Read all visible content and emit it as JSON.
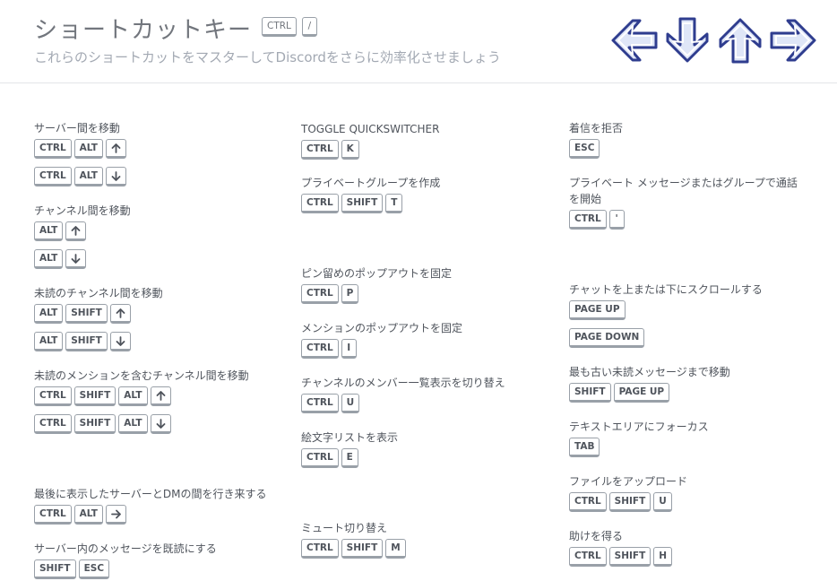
{
  "header": {
    "title": "ショートカットキー",
    "title_keys": [
      "CTRL",
      "/"
    ],
    "subtitle": "これらのショートカットをマスターしてDiscordをさらに効率化させましょう"
  },
  "columns": [
    [
      {
        "label": "サーバー間を移動",
        "rows": [
          [
            "CTRL",
            "ALT",
            "↑"
          ],
          [
            "CTRL",
            "ALT",
            "↓"
          ]
        ]
      },
      {
        "label": "チャンネル間を移動",
        "rows": [
          [
            "ALT",
            "↑"
          ],
          [
            "ALT",
            "↓"
          ]
        ]
      },
      {
        "label": "未読のチャンネル間を移動",
        "rows": [
          [
            "ALT",
            "SHIFT",
            "↑"
          ],
          [
            "ALT",
            "SHIFT",
            "↓"
          ]
        ]
      },
      {
        "label": "未読のメンションを含むチャンネル間を移動",
        "rows": [
          [
            "CTRL",
            "SHIFT",
            "ALT",
            "↑"
          ],
          [
            "CTRL",
            "SHIFT",
            "ALT",
            "↓"
          ]
        ]
      },
      {
        "label": "最後に表示したサーバーとDMの間を行き来する",
        "rows": [
          [
            "CTRL",
            "ALT",
            "→"
          ]
        ]
      },
      {
        "label": "サーバー内のメッセージを既読にする",
        "rows": [
          [
            "SHIFT",
            "ESC"
          ]
        ]
      }
    ],
    [
      {
        "label": "TOGGLE QUICKSWITCHER",
        "rows": [
          [
            "CTRL",
            "K"
          ]
        ]
      },
      {
        "label": "プライベートグループを作成",
        "rows": [
          [
            "CTRL",
            "SHIFT",
            "T"
          ]
        ]
      },
      {
        "label": "ピン留めのポップアウトを固定",
        "rows": [
          [
            "CTRL",
            "P"
          ]
        ]
      },
      {
        "label": "メンションのポップアウトを固定",
        "rows": [
          [
            "CTRL",
            "I"
          ]
        ]
      },
      {
        "label": "チャンネルのメンバー一覧表示を切り替え",
        "rows": [
          [
            "CTRL",
            "U"
          ]
        ]
      },
      {
        "label": "絵文字リストを表示",
        "rows": [
          [
            "CTRL",
            "E"
          ]
        ]
      },
      {
        "label": "ミュート切り替え",
        "rows": [
          [
            "CTRL",
            "SHIFT",
            "M"
          ]
        ]
      }
    ],
    [
      {
        "label": "着信を拒否",
        "rows": [
          [
            "ESC"
          ]
        ]
      },
      {
        "label": "プライベート メッセージまたはグループで通話を開始",
        "rows": [
          [
            "CTRL",
            "'"
          ]
        ]
      },
      {
        "label": "チャットを上または下にスクロールする",
        "rows": [
          [
            "PAGE UP"
          ],
          [
            "PAGE DOWN"
          ]
        ]
      },
      {
        "label": "最も古い未読メッセージまで移動",
        "rows": [
          [
            "SHIFT",
            "PAGE UP"
          ]
        ]
      },
      {
        "label": "テキストエリアにフォーカス",
        "rows": [
          [
            "TAB"
          ]
        ]
      },
      {
        "label": "ファイルをアップロード",
        "rows": [
          [
            "CTRL",
            "SHIFT",
            "U"
          ]
        ]
      },
      {
        "label": "助けを得る",
        "rows": [
          [
            "CTRL",
            "SHIFT",
            "H"
          ]
        ]
      }
    ]
  ],
  "icons": {
    "header_arrows": [
      "arrow-left-icon",
      "arrow-down-icon",
      "arrow-up-icon",
      "arrow-right-icon"
    ]
  },
  "colors": {
    "arrow_fill": "#dfe6f7",
    "arrow_stroke": "#2f3d8f"
  }
}
